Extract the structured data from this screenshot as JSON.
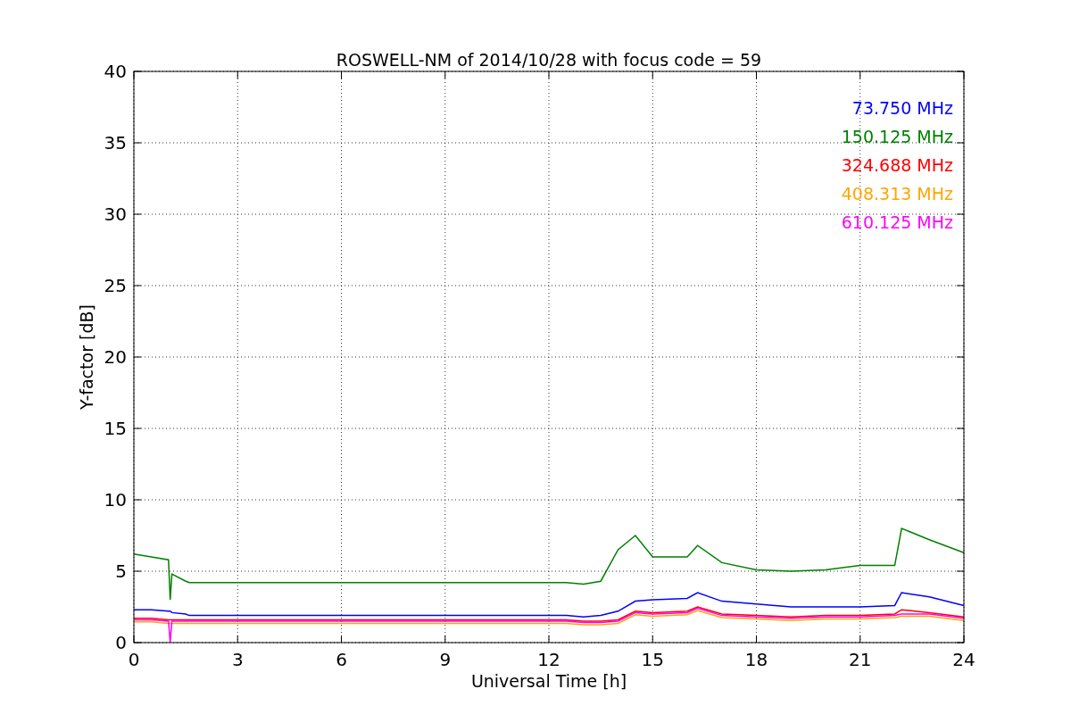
{
  "chart_data": {
    "type": "line",
    "title": "ROSWELL-NM of 2014/10/28 with focus code = 59",
    "xlabel": "Universal Time [h]",
    "ylabel": "Y-factor [dB]",
    "x": [
      0,
      0.5,
      1,
      1.05,
      1.1,
      1.5,
      1.6,
      12.5,
      13,
      13.5,
      14,
      14.5,
      15,
      16,
      16.3,
      17,
      18,
      19,
      20,
      21,
      22,
      22.2,
      23,
      24
    ],
    "series": [
      {
        "name": "73.750 MHz",
        "color": "#0000ff",
        "values": [
          2.3,
          2.3,
          2.2,
          2.2,
          2.1,
          2.0,
          1.9,
          1.9,
          1.8,
          1.9,
          2.2,
          2.9,
          3.0,
          3.1,
          3.5,
          2.9,
          2.7,
          2.5,
          2.5,
          2.5,
          2.6,
          3.5,
          3.2,
          2.6
        ]
      },
      {
        "name": "150.125 MHz",
        "color": "#008000",
        "values": [
          6.2,
          6.0,
          5.8,
          3.0,
          4.8,
          4.3,
          4.2,
          4.2,
          4.1,
          4.3,
          6.5,
          7.5,
          6.0,
          6.0,
          6.8,
          5.6,
          5.1,
          5.0,
          5.1,
          5.4,
          5.4,
          8.0,
          7.2,
          6.3
        ]
      },
      {
        "name": "324.688 MHz",
        "color": "#ff0000",
        "values": [
          1.7,
          1.7,
          1.6,
          1.6,
          1.6,
          1.6,
          1.6,
          1.6,
          1.5,
          1.5,
          1.6,
          2.2,
          2.1,
          2.2,
          2.5,
          2.0,
          1.9,
          1.8,
          1.9,
          1.9,
          2.0,
          2.3,
          2.1,
          1.8
        ]
      },
      {
        "name": "408.313 MHz",
        "color": "#ffa500",
        "values": [
          1.45,
          1.45,
          1.35,
          1.35,
          1.35,
          1.35,
          1.35,
          1.35,
          1.25,
          1.25,
          1.35,
          1.95,
          1.85,
          1.95,
          2.25,
          1.75,
          1.65,
          1.55,
          1.65,
          1.65,
          1.75,
          1.85,
          1.85,
          1.55
        ]
      },
      {
        "name": "610.125 MHz",
        "color": "#ff00ff",
        "values": [
          1.6,
          1.6,
          1.5,
          0,
          1.5,
          1.5,
          1.5,
          1.5,
          1.4,
          1.4,
          1.5,
          2.1,
          2.0,
          2.1,
          2.4,
          1.9,
          1.8,
          1.7,
          1.8,
          1.8,
          1.9,
          2.0,
          2.0,
          1.7
        ]
      }
    ],
    "xlim": [
      0,
      24
    ],
    "ylim": [
      0,
      40
    ],
    "xticks": [
      0,
      3,
      6,
      9,
      12,
      15,
      18,
      21,
      24
    ],
    "yticks": [
      0,
      5,
      10,
      15,
      20,
      25,
      30,
      35,
      40
    ],
    "grid": true
  }
}
